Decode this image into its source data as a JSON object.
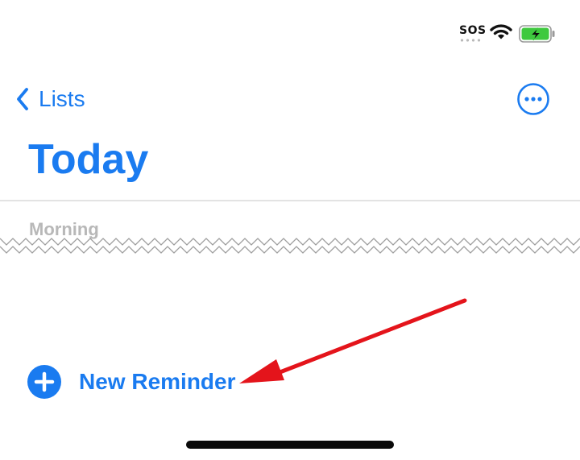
{
  "status_bar": {
    "carrier": "SOS",
    "icons": [
      "sos-indicator",
      "wifi-icon",
      "battery-charging-icon"
    ],
    "battery_color": "#3ec93e"
  },
  "nav": {
    "back_label": "Lists",
    "back_icon": "chevron-left-icon",
    "more_icon": "ellipsis-circle-icon"
  },
  "page": {
    "title": "Today"
  },
  "list": {
    "section_title": "Morning"
  },
  "actions": {
    "new_reminder_label": "New Reminder",
    "new_reminder_icon": "plus-circle-icon"
  },
  "annotation": {
    "arrow_color": "#e4141b"
  },
  "colors": {
    "accent": "#1a7bf0",
    "section_text": "#b8b8b8",
    "divider": "#e3e3e3"
  }
}
